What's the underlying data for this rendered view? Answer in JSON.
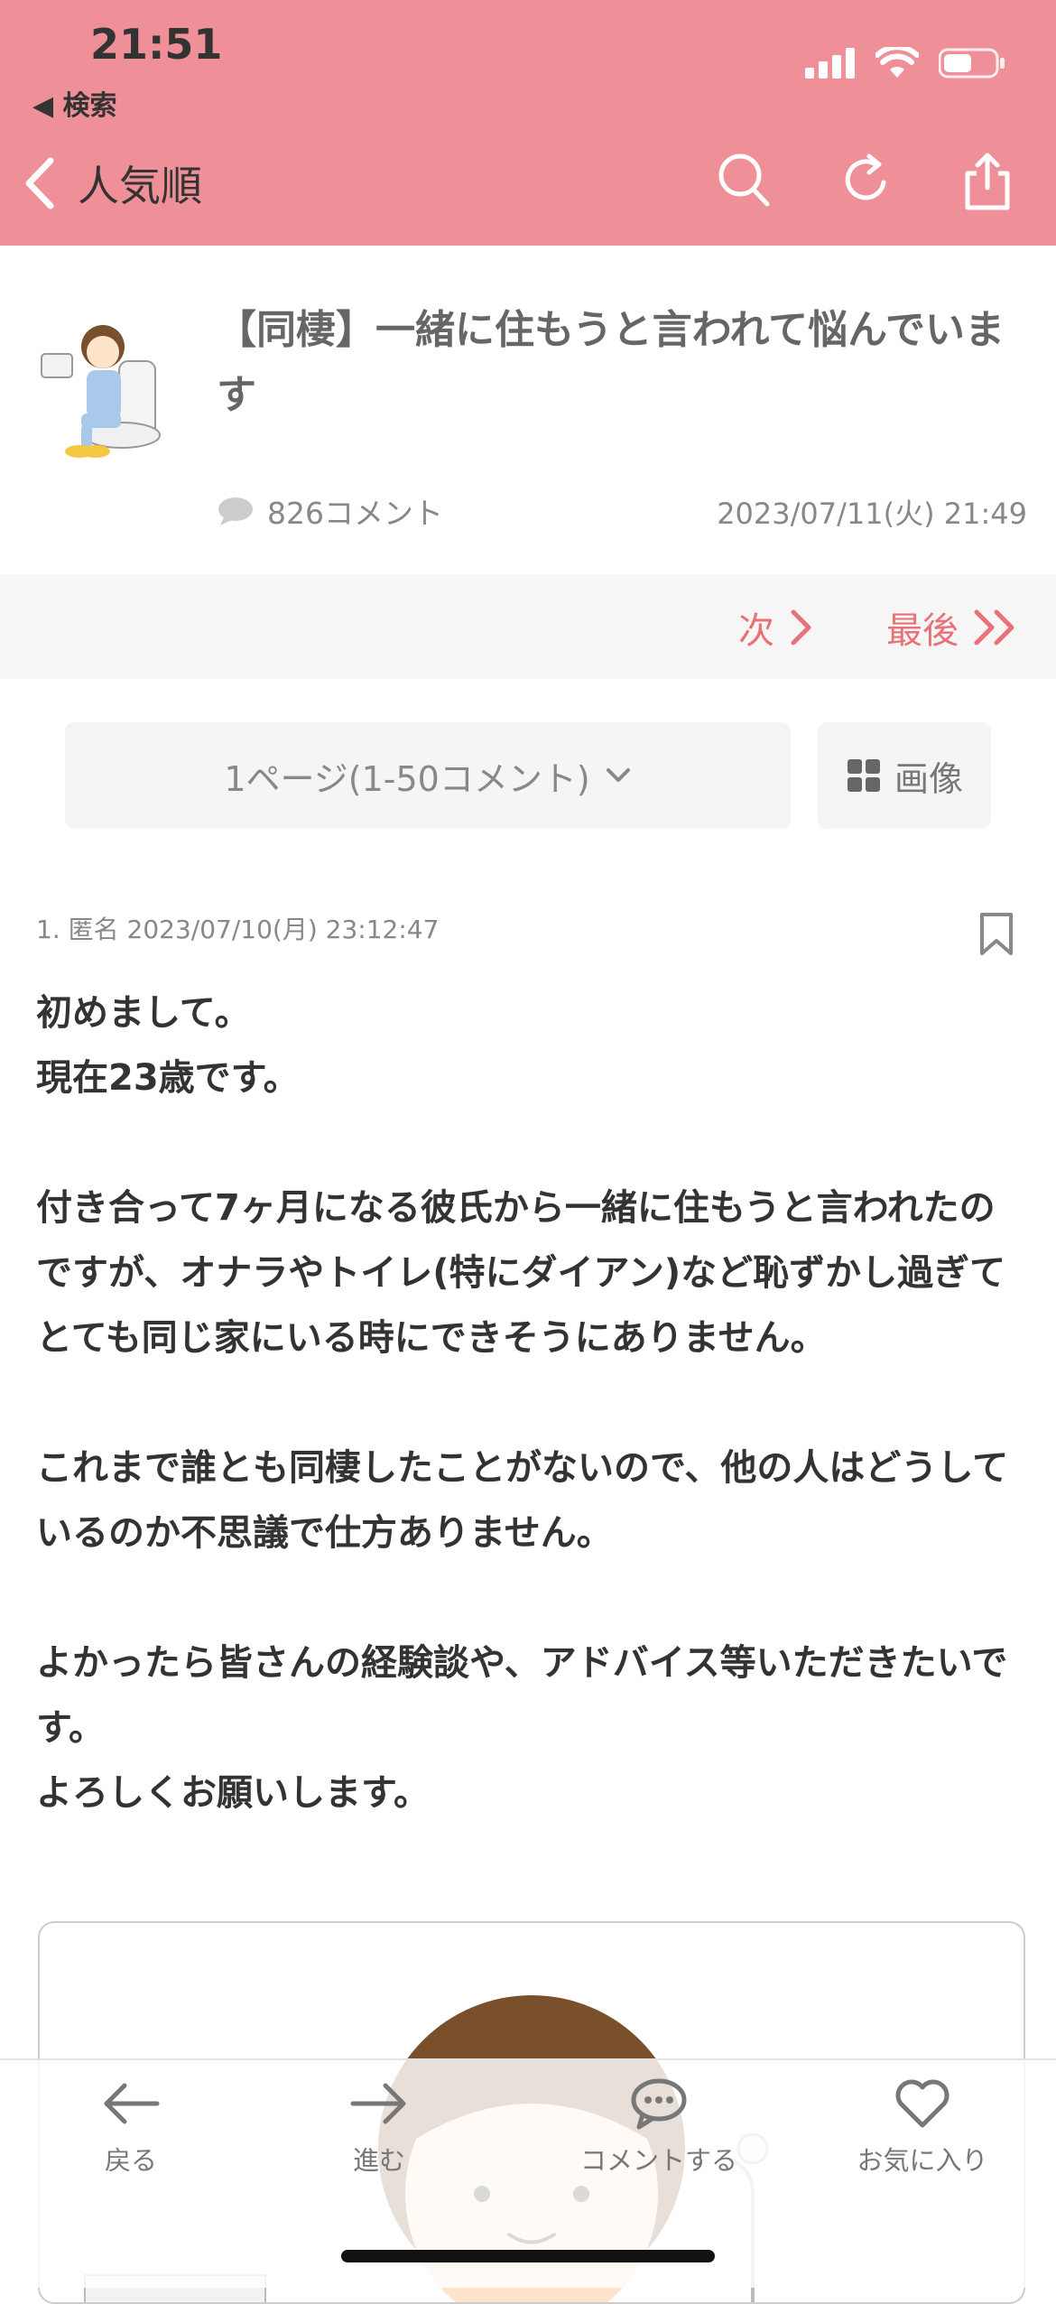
{
  "status_bar": {
    "time": "21:51",
    "back_app_label": "◀ 検索"
  },
  "header": {
    "back_label": "人気順",
    "icons": [
      "search-icon",
      "reload-icon",
      "share-icon"
    ]
  },
  "article": {
    "title": "【同棲】一緒に住もうと言われて悩んでいます",
    "comment_count": "826コメント",
    "posted_at": "2023/07/11(火) 21:49"
  },
  "pager": {
    "next_label": "次",
    "last_label": "最後"
  },
  "page_select": {
    "label": "1ページ(1-50コメント)"
  },
  "image_button": {
    "label": "画像"
  },
  "comment": {
    "meta": "1. 匿名 2023/07/10(月) 23:12:47",
    "lines": [
      "初めまして。",
      "現在23歳です。",
      "",
      "付き合って7ヶ月になる彼氏から一緒に住もうと言われたのですが、オナラやトイレ(特にダイアン)など恥ずかし過ぎてとても同じ家にいる時にできそうにありません。",
      "",
      "これまで誰とも同棲したことがないので、他の人はどうしているのか不思議で仕方ありません。",
      "",
      "よかったら皆さんの経験談や、アドバイス等いただきたいです。",
      "よろしくお願いします。"
    ]
  },
  "tabbar": {
    "items": [
      {
        "label": "戻る",
        "icon": "arrow-left-icon"
      },
      {
        "label": "進む",
        "icon": "arrow-right-icon"
      },
      {
        "label": "コメントする",
        "icon": "speech-bubble-icon"
      },
      {
        "label": "お気に入り",
        "icon": "heart-icon"
      }
    ]
  },
  "colors": {
    "header": "#ef8f97",
    "accent": "#e97178"
  }
}
